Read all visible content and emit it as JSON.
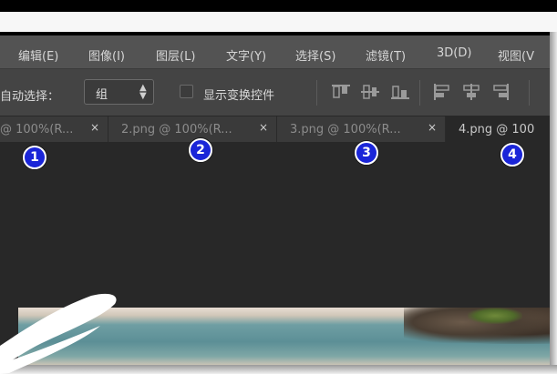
{
  "menu": {
    "items": [
      {
        "label": "编辑(E)"
      },
      {
        "label": "图像(I)"
      },
      {
        "label": "图层(L)"
      },
      {
        "label": "文字(Y)"
      },
      {
        "label": "选择(S)"
      },
      {
        "label": "滤镜(T)"
      },
      {
        "label": "3D(D)"
      },
      {
        "label": "视图(V"
      }
    ]
  },
  "options": {
    "auto_select_label": "自动选择：",
    "auto_select_value": "组",
    "show_transform_label": "显示变换控件",
    "show_transform_checked": false,
    "align_icons": [
      "align-top-edges-icon",
      "align-vertical-centers-icon",
      "align-bottom-edges-icon",
      "align-left-edges-icon",
      "align-horizontal-centers-icon",
      "align-right-edges-icon"
    ]
  },
  "tabs": [
    {
      "label": "@ 100%(R...",
      "close": "×",
      "active": false
    },
    {
      "label": "2.png @ 100%(R...",
      "close": "×",
      "active": false
    },
    {
      "label": "3.png @ 100%(R...",
      "close": "×",
      "active": false
    },
    {
      "label": "4.png @ 100",
      "close": "",
      "active": true
    }
  ],
  "markers": [
    "1",
    "2",
    "3",
    "4"
  ],
  "colors": {
    "menu_bg": "#535353",
    "options_bg": "#444444",
    "workspace_bg": "#282828",
    "marker_blue": "#1a25d8"
  }
}
